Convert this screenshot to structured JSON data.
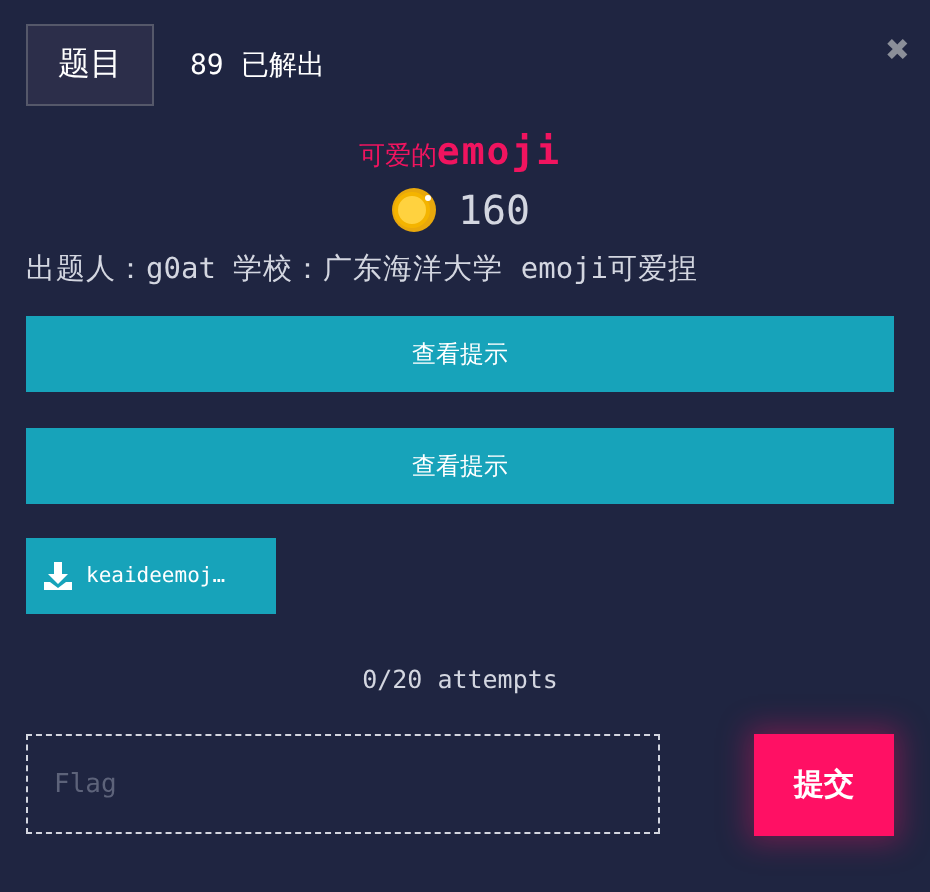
{
  "tabs": [
    {
      "label": "题目",
      "selected": true
    }
  ],
  "solves": "89 已解出",
  "close": "✖",
  "challenge": {
    "title": "可爱的**emoji**",
    "points": "160",
    "description": "出题人：g0at 学校：广东海洋大学 emoji可爱捏"
  },
  "hints": [
    "查看提示",
    "查看提示"
  ],
  "files": [
    "keaideemoj…"
  ],
  "attempts": "0/20 attempts",
  "flag_input": {
    "placeholder": "Flag"
  },
  "submit": "提交"
}
